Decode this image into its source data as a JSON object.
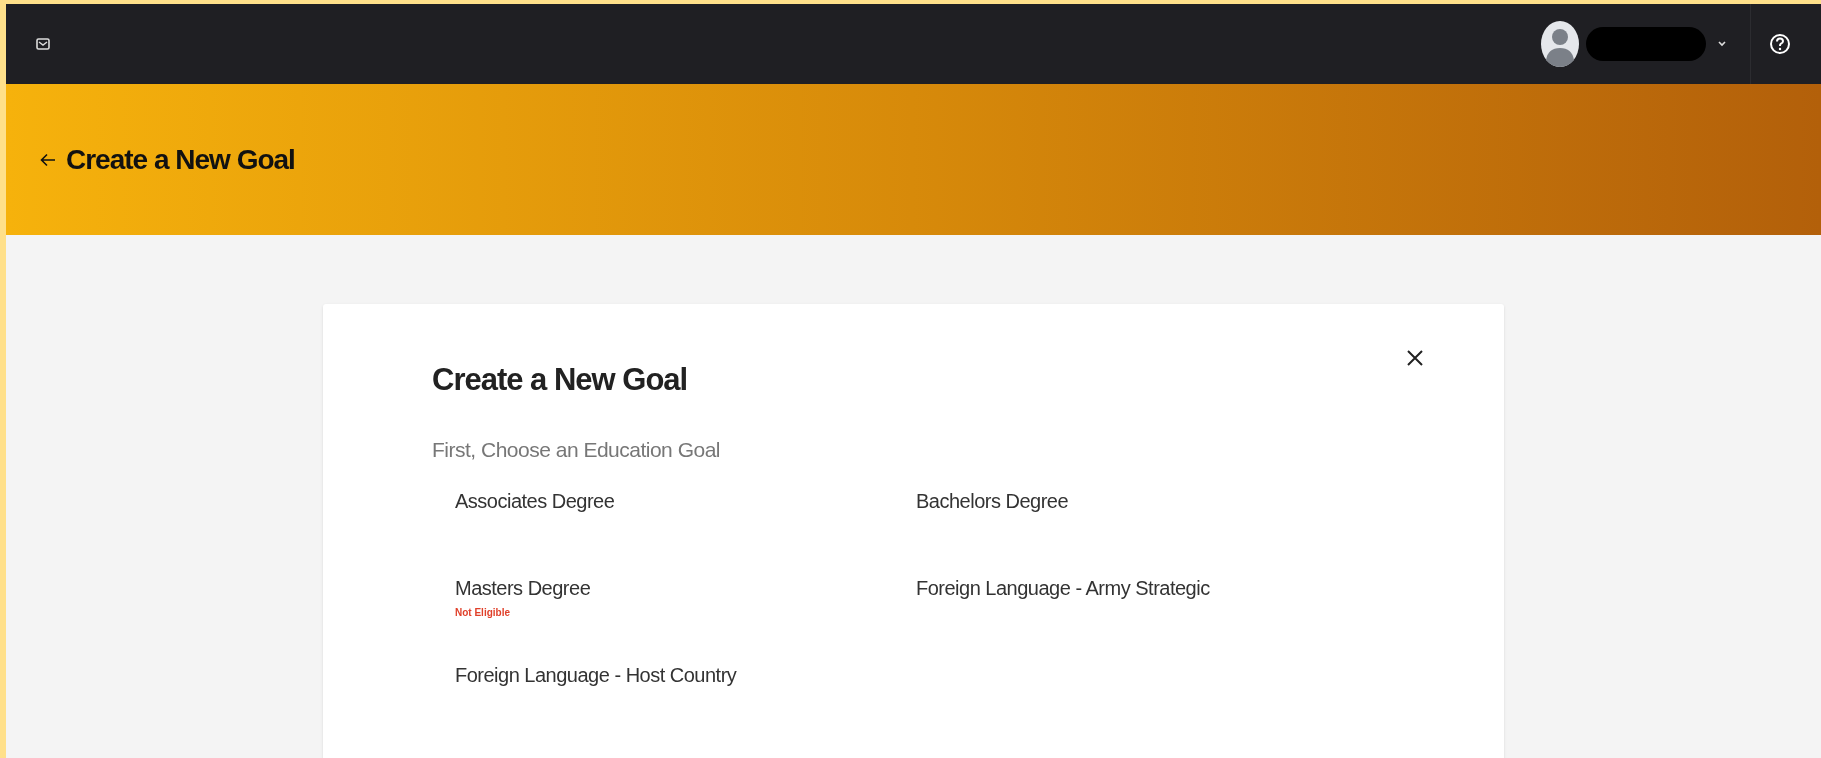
{
  "header": {
    "title": "Create a New Goal"
  },
  "dialog": {
    "title": "Create a New Goal",
    "subtitle": "First, Choose an Education Goal",
    "options": [
      {
        "label": "Associates Degree"
      },
      {
        "label": "Bachelors Degree"
      },
      {
        "label": "Masters Degree",
        "note": "Not Eligible"
      },
      {
        "label": "Foreign Language - Army Strategic"
      },
      {
        "label": "Foreign Language - Host Country"
      }
    ]
  }
}
